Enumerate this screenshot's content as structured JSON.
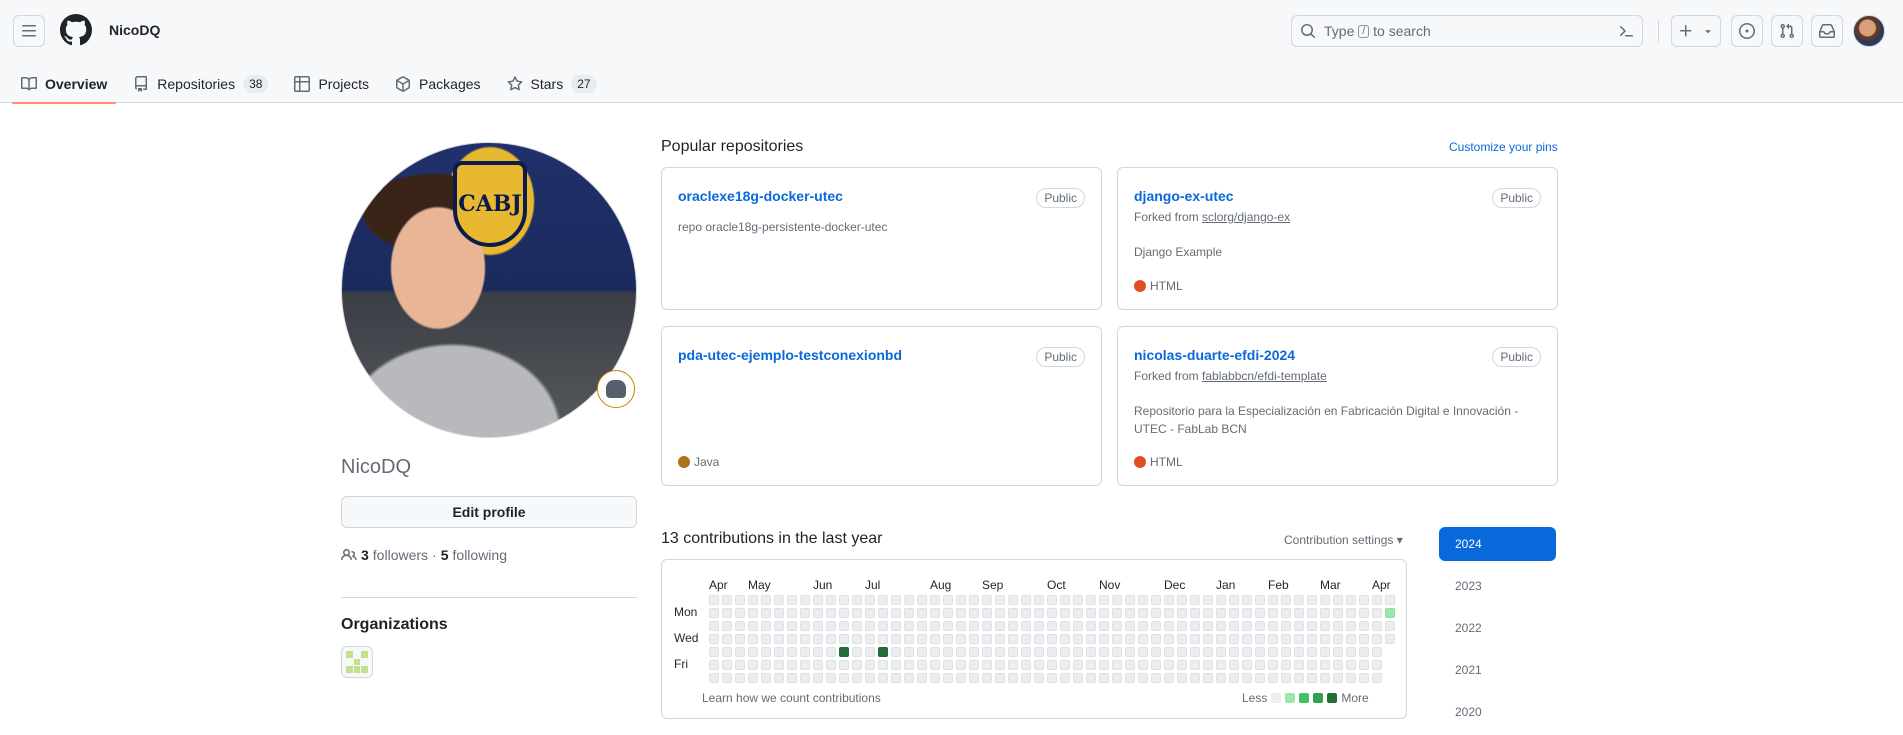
{
  "header": {
    "username": "NicoDQ",
    "search_prefix": "Type",
    "search_key": "/",
    "search_suffix": "to search"
  },
  "tabs": [
    {
      "label": "Overview",
      "count": null,
      "icon": "book-icon"
    },
    {
      "label": "Repositories",
      "count": "38",
      "icon": "repo-icon"
    },
    {
      "label": "Projects",
      "count": null,
      "icon": "table-icon"
    },
    {
      "label": "Packages",
      "count": null,
      "icon": "package-icon"
    },
    {
      "label": "Stars",
      "count": "27",
      "icon": "star-icon"
    }
  ],
  "profile": {
    "name": "NicoDQ",
    "edit_label": "Edit profile",
    "followers_count": "3",
    "followers_label": "followers",
    "separator": "·",
    "following_count": "5",
    "following_label": "following",
    "photo_text": "CABJ",
    "orgs_title": "Organizations"
  },
  "popular": {
    "title": "Popular repositories",
    "customize_label": "Customize your pins",
    "repos": [
      {
        "name": "oraclexe18g-docker-utec",
        "visibility": "Public",
        "forked_prefix": "",
        "forked_from": "",
        "description": "repo oracle18g-persistente-docker-utec",
        "language": "",
        "lang_color": ""
      },
      {
        "name": "django-ex-utec",
        "visibility": "Public",
        "forked_prefix": "Forked from",
        "forked_from": "sclorg/django-ex",
        "description": "Django Example",
        "language": "HTML",
        "lang_color": "#e34c26"
      },
      {
        "name": "pda-utec-ejemplo-testconexionbd",
        "visibility": "Public",
        "forked_prefix": "",
        "forked_from": "",
        "description": "",
        "language": "Java",
        "lang_color": "#b07219"
      },
      {
        "name": "nicolas-duarte-efdi-2024",
        "visibility": "Public",
        "forked_prefix": "Forked from",
        "forked_from": "fablabbcn/efdi-template",
        "description": "Repositorio para la Especialización en Fabricación Digital e Innovación - UTEC - FabLab BCN",
        "language": "HTML",
        "lang_color": "#e34c26"
      }
    ]
  },
  "contributions": {
    "title": "13 contributions in the last year",
    "settings_label": "Contribution settings",
    "months": [
      "Apr",
      "May",
      "Jun",
      "Jul",
      "Aug",
      "Sep",
      "Oct",
      "Nov",
      "Dec",
      "Jan",
      "Feb",
      "Mar",
      "Apr"
    ],
    "day_labels": [
      "Mon",
      "Wed",
      "Fri"
    ],
    "learn_label": "Learn how we count contributions",
    "legend_less": "Less",
    "legend_more": "More",
    "levels_colors": [
      "#ebedf0",
      "#9be9a8",
      "#40c463",
      "#30a14e",
      "#216e39"
    ],
    "weeks": 53,
    "active_cells": [
      {
        "week": 10,
        "day": 4,
        "level": 4
      },
      {
        "week": 13,
        "day": 4,
        "level": 4
      },
      {
        "week": 52,
        "day": 1,
        "level": 1
      }
    ]
  },
  "years": [
    "2024",
    "2023",
    "2022",
    "2021",
    "2020"
  ],
  "colors": {
    "accent": "#0969da",
    "tab_underline": "#fd8c73"
  }
}
